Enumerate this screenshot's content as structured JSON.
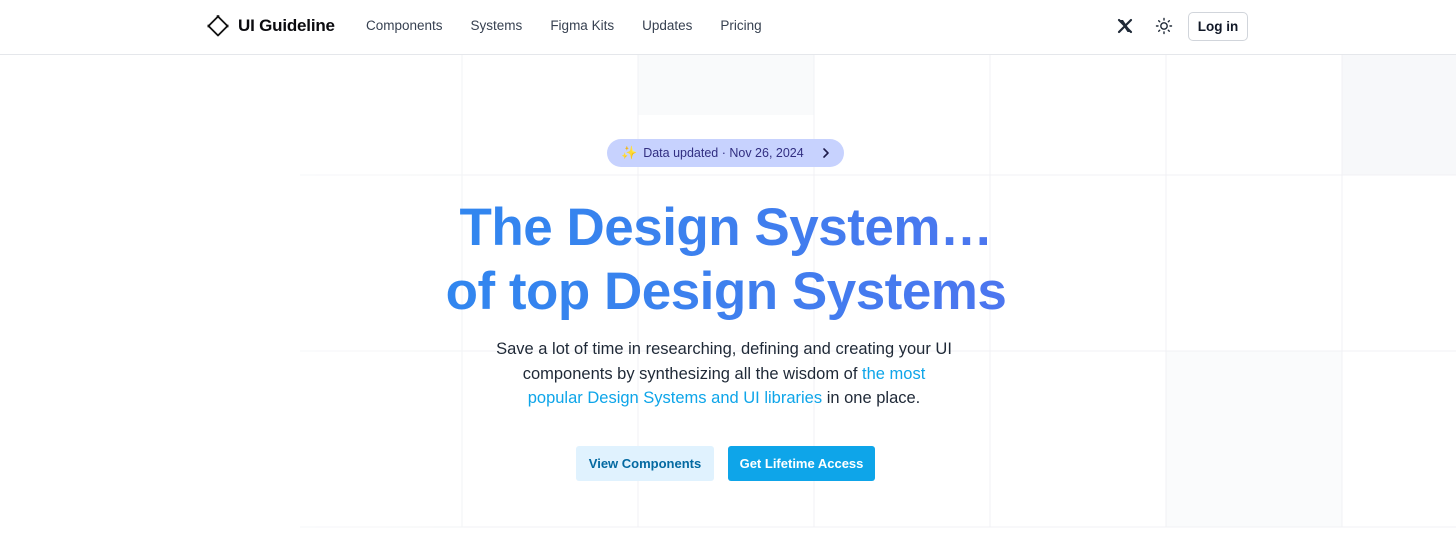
{
  "header": {
    "logo_text": "UI Guideline",
    "nav": [
      {
        "label": "Components"
      },
      {
        "label": "Systems"
      },
      {
        "label": "Figma Kits"
      },
      {
        "label": "Updates"
      },
      {
        "label": "Pricing"
      }
    ],
    "login_label": "Log in",
    "icons": {
      "logo": "diamond-logo-icon",
      "social": "x-icon",
      "theme": "sun-icon"
    }
  },
  "hero": {
    "badge": {
      "sparkle": "✨",
      "text": "Data updated · Nov 26, 2024"
    },
    "title_line1": "The Design System…",
    "title_line2": "of top Design Systems",
    "subtitle_pre": "Save a lot of time in researching, defining and creating your UI components by synthesizing all the wisdom of ",
    "subtitle_link": "the most popular Design Systems and UI libraries",
    "subtitle_post": " in one place.",
    "btn_secondary": "View Components",
    "btn_primary": "Get Lifetime Access"
  },
  "colors": {
    "accent": "#0ea5e9",
    "title_gradient_start": "#1d8ff2",
    "title_gradient_end": "#6366f1",
    "badge_bg": "#c7d2fe",
    "secondary_btn_bg": "#e0f2fe"
  }
}
